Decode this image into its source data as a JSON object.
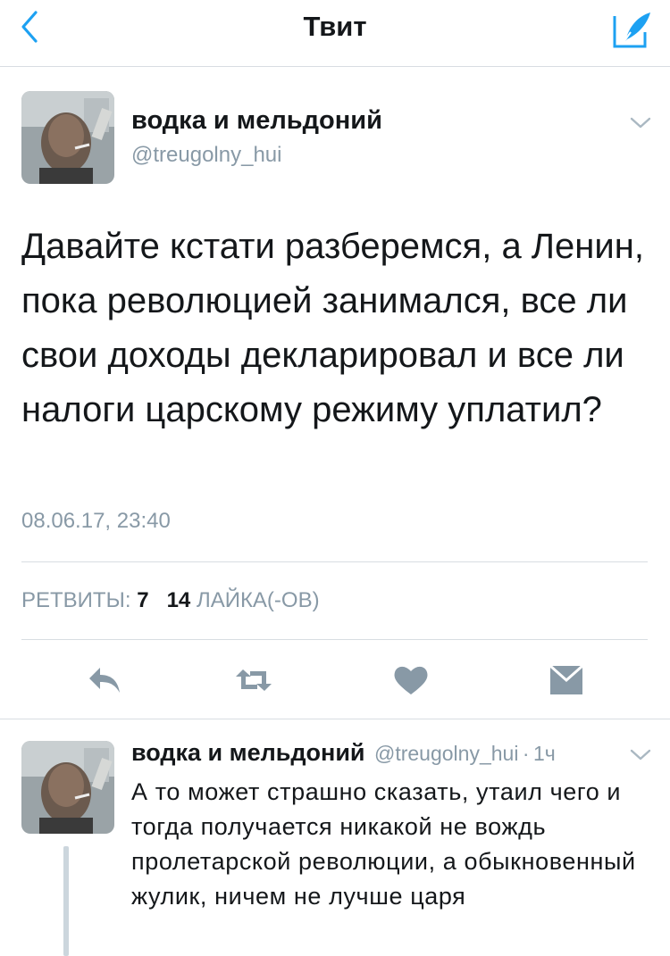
{
  "navbar": {
    "title": "Твит",
    "back_icon": "chevron-left-icon",
    "compose_icon": "compose-quill-icon",
    "accent_color": "#1da1f2"
  },
  "tweet": {
    "author_name": "водка и мельдоний",
    "author_handle": "@treugolny_hui",
    "text": "Давайте кстати разберемся, а Ленин, пока революцией занимался, все ли свои доходы декларировал и все ли налоги царскому режиму уплатил?",
    "timestamp": "08.06.17, 23:40",
    "stats": {
      "retweets_label": "РЕТВИТЫ:",
      "retweets_count": "7",
      "likes_count": "14",
      "likes_label": "ЛАЙКА(-ОВ)"
    },
    "actions": [
      "reply-icon",
      "retweet-icon",
      "heart-icon",
      "envelope-icon"
    ]
  },
  "reply": {
    "author_name": "водка и мельдоний",
    "author_handle": "@treugolny_hui",
    "dot": "·",
    "time": "1ч",
    "text": "А то может страшно сказать, утаил чего и тогда получается никакой не вождь пролетарской революции, а обыкновенный жулик, ничем не лучше царя"
  },
  "colors": {
    "secondary_text": "#8899a6",
    "primary_text": "#14171a",
    "icon_gray": "#8899a6",
    "divider": "#d8dde2"
  }
}
